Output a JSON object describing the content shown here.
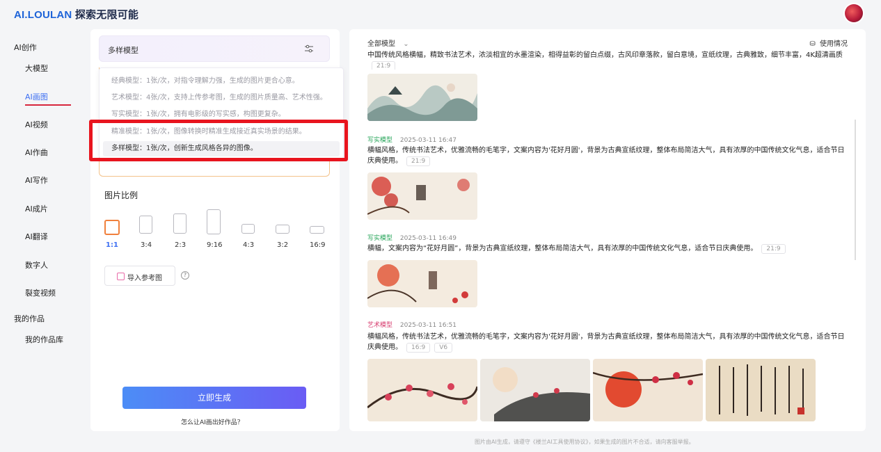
{
  "header": {
    "brand": "AI.LOULAN",
    "tagline": "探索无限可能"
  },
  "nav": {
    "section_create": "AI创作",
    "items": [
      "大模型",
      "AI画图",
      "AI视频",
      "AI作曲",
      "AI写作",
      "AI成片",
      "AI翻译",
      "数字人",
      "裂变视频"
    ],
    "active_index": 1,
    "section_works": "我的作品",
    "works_items": [
      "我的作品库"
    ]
  },
  "panel": {
    "model_select_value": "多样模型",
    "model_options": [
      "经典模型：1张/次，对指令理解力强，生成的图片更合心意。",
      "艺术模型：4张/次，支持上传参考图，生成的图片质量高、艺术性强。",
      "写实模型：1张/次，拥有电影级的写实感，构图更复杂。",
      "精准模型：1张/次，图像转换时精准生成接近真实场景的结果。",
      "多样模型：1张/次，创新生成风格各异的图像。"
    ],
    "selected_option_index": 4,
    "ratio_title": "图片比例",
    "ratios": [
      "1:1",
      "3:4",
      "2:3",
      "9:16",
      "4:3",
      "3:2",
      "16:9"
    ],
    "active_ratio_index": 0,
    "upload_label": "导入参考图",
    "generate_label": "立即生成",
    "help_link": "怎么让AI画出好作品？"
  },
  "results": {
    "filter_label": "全部模型",
    "usage_label": "使用情况",
    "entries": [
      {
        "text": "中国传统风格横幅，精致书法艺术，浓淡相宜的水墨渲染，相得益彰的留白点缀，古风印章落款，留白意境，宣纸纹理，古典雅致，细节丰富，4K超清画质",
        "tags": [
          "21:9"
        ]
      },
      {
        "type": "写实模型",
        "time": "2025-03-11 16:47",
        "text": "横幅风格，传统书法艺术，优雅流畅的毛笔字，文案内容为'花好月圆'，背景为古典宣纸纹理，整体布局简洁大气，具有浓厚的中国传统文化气息，适合节日庆典使用。",
        "tags": [
          "21:9"
        ]
      },
      {
        "type": "写实模型",
        "time": "2025-03-11 16:49",
        "text": "横幅，文案内容为“花好月圆”，背景为古典宣纸纹理，整体布局简洁大气，具有浓厚的中国传统文化气息，适合节日庆典使用。",
        "tags": [
          "21:9"
        ]
      },
      {
        "type": "艺术模型",
        "time": "2025-03-11 16:51",
        "text": "横幅风格，传统书法艺术，优雅流畅的毛笔字，文案内容为'花好月圆'，背景为古典宣纸纹理，整体布局简洁大气，具有浓厚的中国传统文化气息，适合节日庆典使用。",
        "tags": [
          "16:9",
          "V6"
        ]
      }
    ]
  },
  "footer_note": "图片由AI生成，请遵守《楼兰AI工具使用协议》，如果生成的图片不合适，请向客服举报。",
  "colors": {
    "accent": "#3d6ff2",
    "highlight": "#e8141e",
    "realistic": "#27a55a",
    "art": "#d73b6e"
  }
}
